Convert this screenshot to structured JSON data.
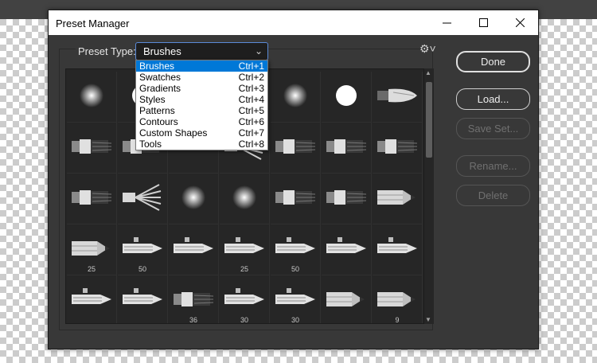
{
  "window": {
    "title": "Preset Manager"
  },
  "preset": {
    "label": "Preset Type:",
    "selected": "Brushes",
    "options": [
      {
        "label": "Brushes",
        "shortcut": "Ctrl+1"
      },
      {
        "label": "Swatches",
        "shortcut": "Ctrl+2"
      },
      {
        "label": "Gradients",
        "shortcut": "Ctrl+3"
      },
      {
        "label": "Styles",
        "shortcut": "Ctrl+4"
      },
      {
        "label": "Patterns",
        "shortcut": "Ctrl+5"
      },
      {
        "label": "Contours",
        "shortcut": "Ctrl+6"
      },
      {
        "label": "Custom Shapes",
        "shortcut": "Ctrl+7"
      },
      {
        "label": "Tools",
        "shortcut": "Ctrl+8"
      }
    ]
  },
  "buttons": {
    "done": "Done",
    "load": "Load...",
    "save_set": "Save Set...",
    "rename": "Rename...",
    "delete": "Delete"
  },
  "brushes": [
    [
      {
        "icon": "soft-round-icon",
        "label": ""
      },
      {
        "icon": "hard-round-icon",
        "label": ""
      },
      {
        "icon": "hidden",
        "label": ""
      },
      {
        "icon": "hidden",
        "label": ""
      },
      {
        "icon": "soft-round-icon",
        "label": ""
      },
      {
        "icon": "hard-round-icon",
        "label": ""
      },
      {
        "icon": "bristle-tip-icon",
        "label": ""
      }
    ],
    [
      {
        "icon": "flat-brush-icon",
        "label": ""
      },
      {
        "icon": "flat-brush-icon",
        "label": ""
      },
      {
        "icon": "hidden",
        "label": ""
      },
      {
        "icon": "fan-brush-icon",
        "label": ""
      },
      {
        "icon": "flat-brush-icon",
        "label": ""
      },
      {
        "icon": "flat-brush-icon",
        "label": ""
      },
      {
        "icon": "flat-brush-icon",
        "label": ""
      }
    ],
    [
      {
        "icon": "flat-brush-icon",
        "label": ""
      },
      {
        "icon": "fan-brush-icon",
        "label": ""
      },
      {
        "icon": "soft-round-icon",
        "label": ""
      },
      {
        "icon": "soft-round-icon",
        "label": ""
      },
      {
        "icon": "flat-brush-icon",
        "label": ""
      },
      {
        "icon": "flat-brush-icon",
        "label": ""
      },
      {
        "icon": "pencil-icon",
        "label": ""
      }
    ],
    [
      {
        "icon": "pencil-icon",
        "label": "25"
      },
      {
        "icon": "airbrush-icon",
        "label": "50"
      },
      {
        "icon": "airbrush-icon",
        "label": ""
      },
      {
        "icon": "airbrush-icon",
        "label": "25"
      },
      {
        "icon": "airbrush-icon",
        "label": "50"
      },
      {
        "icon": "airbrush-icon",
        "label": ""
      },
      {
        "icon": "airbrush-icon",
        "label": ""
      }
    ],
    [
      {
        "icon": "airbrush-icon",
        "label": ""
      },
      {
        "icon": "airbrush-icon",
        "label": ""
      },
      {
        "icon": "flat-brush-icon",
        "label": "36"
      },
      {
        "icon": "airbrush-icon",
        "label": "30"
      },
      {
        "icon": "airbrush-icon",
        "label": "30"
      },
      {
        "icon": "pencil-icon",
        "label": ""
      },
      {
        "icon": "pencil-icon",
        "label": "9"
      }
    ]
  ]
}
